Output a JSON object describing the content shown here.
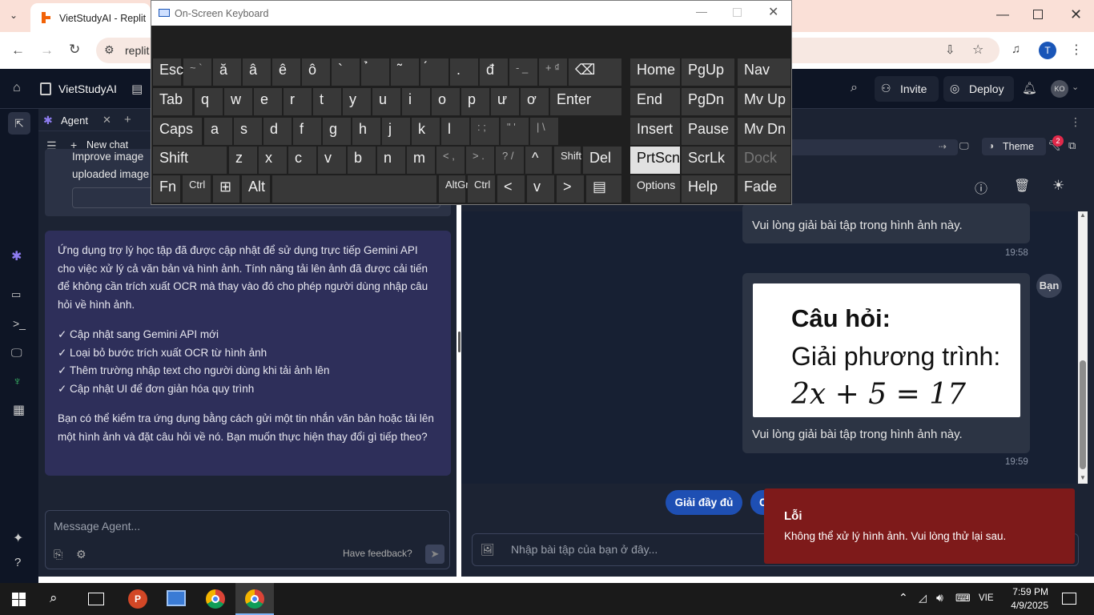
{
  "browser": {
    "tab_title": "VietStudyAI - Replit",
    "url_partial": "replit",
    "profile_initial": "T"
  },
  "replit": {
    "project_name": "VietStudyAI",
    "invite_label": "Invite",
    "deploy_label": "Deploy",
    "avatar_initials": "KO",
    "agent_tab_label": "Agent",
    "new_chat_label": "New chat",
    "theme_label": "Theme",
    "notification_count": "2"
  },
  "agent": {
    "previous_message_line1": "Improve image",
    "previous_message_line2": "uploaded image",
    "card_paragraph1": "Ứng dụng trợ lý học tập đã được cập nhật để sử dụng trực tiếp Gemini API cho việc xử lý cả văn bản và hình ảnh. Tính năng tải lên ảnh đã được cải tiến để không cần trích xuất OCR mà thay vào đó cho phép người dùng nhập câu hỏi về hình ảnh.",
    "checklist": [
      "✓ Cập nhật sang Gemini API mới",
      "✓ Loại bỏ bước trích xuất OCR từ hình ảnh",
      "✓ Thêm trường nhập text cho người dùng khi tải ảnh lên",
      "✓ Cập nhật UI để đơn giản hóa quy trình"
    ],
    "card_paragraph2": "Bạn có thể kiểm tra ứng dụng bằng cách gửi một tin nhắn văn bản hoặc tải lên một hình ảnh và đặt câu hỏi về nó. Bạn muốn thực hiện thay đổi gì tiếp theo?",
    "input_placeholder": "Message Agent...",
    "feedback_label": "Have feedback?"
  },
  "chat": {
    "msg1_text": "Vui lòng giải bài tập trong hình ảnh này.",
    "msg1_time": "19:58",
    "msg2_image_line1": "Câu hỏi:",
    "msg2_image_line2": "Giải phương trình:",
    "msg2_image_line3": "2x + 5 = 17",
    "msg2_text": "Vui lòng giải bài tập trong hình ảnh này.",
    "msg2_time": "19:59",
    "sender_label": "Bạn",
    "quick_action_1": "Giải đầy đủ",
    "quick_action_2": "C",
    "input_placeholder": "Nhập bài tập của bạn ở đây..."
  },
  "toast": {
    "title": "Lỗi",
    "message": "Không thể xử lý hình ảnh. Vui lòng thử lại sau."
  },
  "osk": {
    "title": "On-Screen Keyboard",
    "row1": [
      "Esc",
      "~ `",
      "ă",
      "â",
      "ê",
      "ô",
      "`",
      "̉",
      "̃",
      "́",
      ".",
      "đ",
      "- _",
      "+ ₫",
      "⌫"
    ],
    "row2": [
      "Tab",
      "q",
      "w",
      "e",
      "r",
      "t",
      "y",
      "u",
      "i",
      "o",
      "p",
      "ư",
      "ơ",
      "Enter"
    ],
    "row3": [
      "Caps",
      "a",
      "s",
      "d",
      "f",
      "g",
      "h",
      "j",
      "k",
      "l",
      ": ;",
      "\" '",
      "| \\"
    ],
    "row4": [
      "Shift",
      "z",
      "x",
      "c",
      "v",
      "b",
      "n",
      "m",
      "< ,",
      "> .",
      "? /",
      "^",
      "Shift",
      "Del"
    ],
    "row5": [
      "Fn",
      "Ctrl",
      "⊞",
      "Alt",
      "",
      "AltGr",
      "Ctrl",
      "<",
      "v",
      ">",
      "▤"
    ],
    "nav": [
      "Home",
      "PgUp",
      "Nav",
      "End",
      "PgDn",
      "Mv Up",
      "Insert",
      "Pause",
      "Mv Dn",
      "PrtScn",
      "ScrLk",
      "Dock",
      "Options",
      "Help",
      "Fade"
    ]
  },
  "taskbar": {
    "time": "7:59 PM",
    "date": "4/9/2025",
    "language": "VIE"
  }
}
